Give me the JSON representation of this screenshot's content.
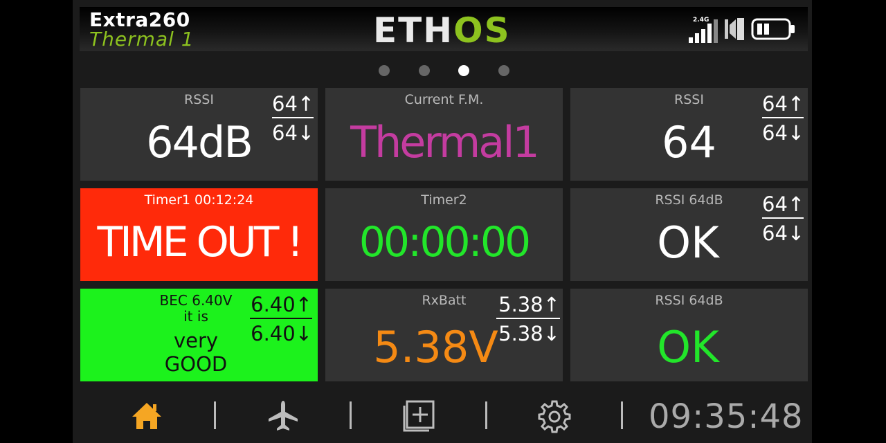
{
  "header": {
    "model_name": "Extra260",
    "flight_mode": "Thermal 1",
    "logo_left": "ETH",
    "logo_right": "OS",
    "band_label": "2.4G",
    "colors": {
      "mode": "#8dc21f",
      "logo_accent": "#8dc21f"
    }
  },
  "pager": {
    "pages": 4,
    "active": 3
  },
  "tiles": {
    "t1": {
      "label": "RSSI",
      "value": "64dB",
      "max": "64↑",
      "min": "64↓"
    },
    "t2": {
      "label": "Current F.M.",
      "value": "Thermal1",
      "color": "#c43ca0"
    },
    "t3": {
      "label": "RSSI",
      "value": "64",
      "max": "64↑",
      "min": "64↓"
    },
    "t4": {
      "label": "Timer1  00:12:24",
      "value": "TIME OUT !",
      "bg": "#ff2a0a"
    },
    "t5": {
      "label": "Timer2",
      "value": "00:00:00",
      "color": "#22e62a"
    },
    "t6": {
      "label": "RSSI 64dB",
      "value": "OK",
      "max": "64↑",
      "min": "64↓"
    },
    "t7": {
      "label_line1": "BEC 6.40V",
      "label_line2": "it is",
      "value_line1": "very",
      "value_line2": "GOOD",
      "max": "6.40↑",
      "min": "6.40↓",
      "bg": "#1cf21c"
    },
    "t8": {
      "label": "RxBatt",
      "value": "5.38V",
      "max": "5.38↑",
      "min": "5.38↓",
      "color": "#f58a14"
    },
    "t9": {
      "label": "RSSI 64dB",
      "value": "OK",
      "color": "#22e62a"
    }
  },
  "bottom_bar": {
    "icons": [
      "home-icon",
      "airplane-icon",
      "layout-icon",
      "gear-icon"
    ],
    "clock": "09:35:48",
    "colors": {
      "home": "#f5a623",
      "icon": "#bdbdbd"
    }
  }
}
